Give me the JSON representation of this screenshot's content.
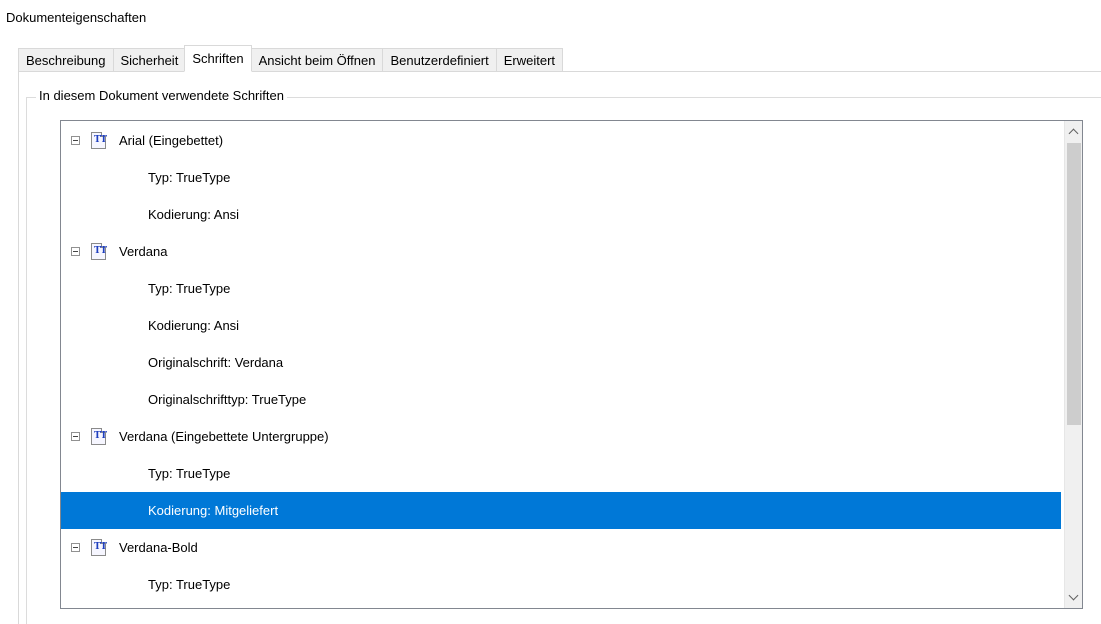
{
  "window": {
    "title": "Dokumenteigenschaften"
  },
  "tabs": [
    {
      "label": "Beschreibung",
      "active": false
    },
    {
      "label": "Sicherheit",
      "active": false
    },
    {
      "label": "Schriften",
      "active": true
    },
    {
      "label": "Ansicht beim Öffnen",
      "active": false
    },
    {
      "label": "Benutzerdefiniert",
      "active": false
    },
    {
      "label": "Erweitert",
      "active": false
    }
  ],
  "fonts_group": {
    "label": "In diesem Dokument verwendete Schriften",
    "rows": [
      {
        "kind": "parent",
        "text": "Arial (Eingebettet)"
      },
      {
        "kind": "child",
        "text": "Typ: TrueType"
      },
      {
        "kind": "child",
        "text": "Kodierung: Ansi"
      },
      {
        "kind": "parent",
        "text": "Verdana"
      },
      {
        "kind": "child",
        "text": "Typ: TrueType"
      },
      {
        "kind": "child",
        "text": "Kodierung: Ansi"
      },
      {
        "kind": "child",
        "text": "Originalschrift: Verdana"
      },
      {
        "kind": "child",
        "text": "Originalschrifttyp: TrueType"
      },
      {
        "kind": "parent",
        "text": "Verdana (Eingebettete Untergruppe)"
      },
      {
        "kind": "child",
        "text": "Typ: TrueType"
      },
      {
        "kind": "child",
        "text": "Kodierung: Mitgeliefert",
        "selected": true
      },
      {
        "kind": "parent",
        "text": "Verdana-Bold"
      },
      {
        "kind": "child",
        "text": "Typ: TrueType"
      }
    ]
  },
  "colors": {
    "selection": "#0078d7",
    "font_icon_glyph": "#1f3fbf"
  },
  "icons": {
    "expander": "collapse-minus-icon",
    "font": "truetype-font-icon"
  }
}
